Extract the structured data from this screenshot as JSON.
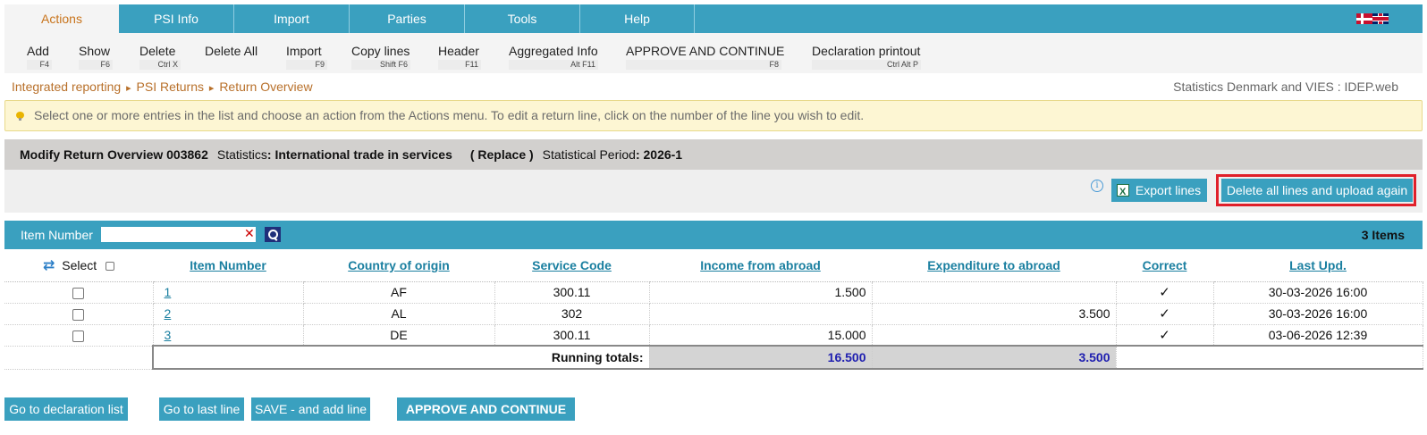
{
  "tabs": [
    {
      "label": "Actions",
      "active": true
    },
    {
      "label": "PSI Info"
    },
    {
      "label": "Import"
    },
    {
      "label": "Parties"
    },
    {
      "label": "Tools"
    },
    {
      "label": "Help"
    }
  ],
  "languages": [
    "flag-denmark-icon",
    "flag-uk-icon"
  ],
  "actions": [
    {
      "label": "Add",
      "shortcut": "F4"
    },
    {
      "label": "Show",
      "shortcut": "F6"
    },
    {
      "label": "Delete",
      "shortcut": "Ctrl X"
    },
    {
      "label": "Delete All",
      "shortcut": ""
    },
    {
      "label": "Import",
      "shortcut": "F9"
    },
    {
      "label": "Copy lines",
      "shortcut": "Shift F6"
    },
    {
      "label": "Header",
      "shortcut": "F11"
    },
    {
      "label": "Aggregated Info",
      "shortcut": "Alt F11"
    },
    {
      "label": "APPROVE AND CONTINUE",
      "shortcut": "F8"
    },
    {
      "label": "Declaration printout",
      "shortcut": "Ctrl Alt P"
    }
  ],
  "breadcrumb": [
    "Integrated reporting",
    "PSI Returns",
    "Return Overview"
  ],
  "breadcrumb_sep": "▸",
  "site_name": "Statistics Denmark and VIES : IDEP.web",
  "info_message": "Select one or more entries in the list and choose an action from the Actions menu. To edit a return line, click on the number of the line you wish to edit.",
  "header": {
    "title": "Modify Return Overview 003862",
    "statistics_label": "Statistics",
    "statistics_value": ": International trade in services",
    "mode": "( Replace )",
    "period_label": "Statistical Period",
    "period_value": ": 2026-1"
  },
  "toolbar": {
    "info_glyph": "i",
    "export_label": "Export lines",
    "delete_upload_label": "Delete all lines and upload again"
  },
  "search": {
    "label": "Item Number",
    "value": "",
    "clear_glyph": "✕",
    "items_count": "3 Items"
  },
  "table": {
    "select_label": "Select",
    "refresh_glyph": "⇄",
    "columns": [
      "Item Number",
      "Country of origin",
      "Service Code",
      "Income from abroad",
      "Expenditure to abroad",
      "Correct",
      "Last Upd."
    ],
    "rows": [
      {
        "item": "1",
        "country": "AF",
        "service": "300.11",
        "income": "1.500",
        "expenditure": "",
        "correct": "✓",
        "updated": "30-03-2026 16:00"
      },
      {
        "item": "2",
        "country": "AL",
        "service": "302",
        "income": "",
        "expenditure": "3.500",
        "correct": "✓",
        "updated": "30-03-2026 16:00"
      },
      {
        "item": "3",
        "country": "DE",
        "service": "300.11",
        "income": "15.000",
        "expenditure": "",
        "correct": "✓",
        "updated": "03-06-2026 12:39"
      }
    ],
    "totals": {
      "label": "Running totals:",
      "income": "16.500",
      "expenditure": "3.500"
    }
  },
  "bottom_buttons": {
    "declaration_list": "Go to declaration list",
    "last_line": "Go to last line",
    "save_add": "SAVE - and add line",
    "approve": "APPROVE AND CONTINUE"
  },
  "colors": {
    "accent": "#3aa0bf",
    "active_tab_text": "#c8741c",
    "link": "#1a7fa0",
    "highlight": "#e0202a",
    "totals_text": "#2020b0"
  }
}
